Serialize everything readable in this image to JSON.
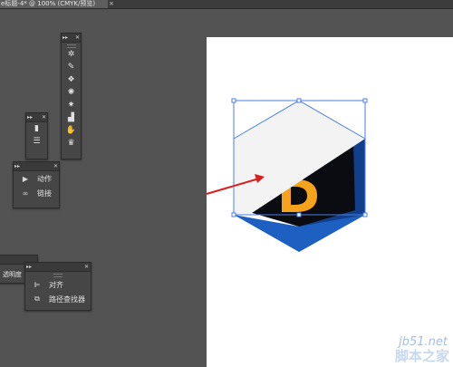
{
  "document_tab": {
    "title": "e标题-4* @ 100% (CMYK/预览)",
    "close": "×"
  },
  "panel_controls": {
    "collapse": "▸▸",
    "close": "✕"
  },
  "tools_panel": {
    "tools": [
      {
        "icon": "symbol-sprayer-icon",
        "glyph": "✲"
      },
      {
        "icon": "symbol-shifter-icon",
        "glyph": "✎"
      },
      {
        "icon": "symbol-scruncher-icon",
        "glyph": "❖"
      },
      {
        "icon": "symbol-sizer-icon",
        "glyph": "✺"
      },
      {
        "icon": "symbol-spinner-icon",
        "glyph": "✷"
      },
      {
        "icon": "symbol-stainer-icon",
        "glyph": "▟"
      },
      {
        "icon": "symbol-screener-icon",
        "glyph": "✋"
      },
      {
        "icon": "symbol-styler-icon",
        "glyph": "♛"
      }
    ]
  },
  "small_panel": {
    "items": [
      {
        "icon": "gradient-icon",
        "glyph": "▮"
      },
      {
        "icon": "stroke-icon",
        "glyph": "☰"
      }
    ]
  },
  "actions_panel": {
    "items": [
      {
        "icon": "play-icon",
        "glyph": "▶",
        "label": "动作"
      },
      {
        "icon": "link-icon",
        "glyph": "∞",
        "label": "链接"
      }
    ]
  },
  "transparency_panel": {
    "tab_label": "透明度"
  },
  "align_panel": {
    "items": [
      {
        "icon": "align-icon",
        "glyph": "⊫",
        "label": "对齐"
      },
      {
        "icon": "pathfinder-icon",
        "glyph": "⧉",
        "label": "路径查找器"
      }
    ]
  },
  "artwork": {
    "letter": "D",
    "colors": {
      "hex_dark": "#0b0b12",
      "hex_blue": "#1e5fc2",
      "hex_blue_dark": "#123f8c",
      "letter": "#f7a21b",
      "overlay": "#f2f3f2",
      "selection": "#4a7fe6",
      "arrow": "#d91e1e"
    }
  },
  "watermark": {
    "url": "jb51.net",
    "brand": "脚本之家"
  }
}
